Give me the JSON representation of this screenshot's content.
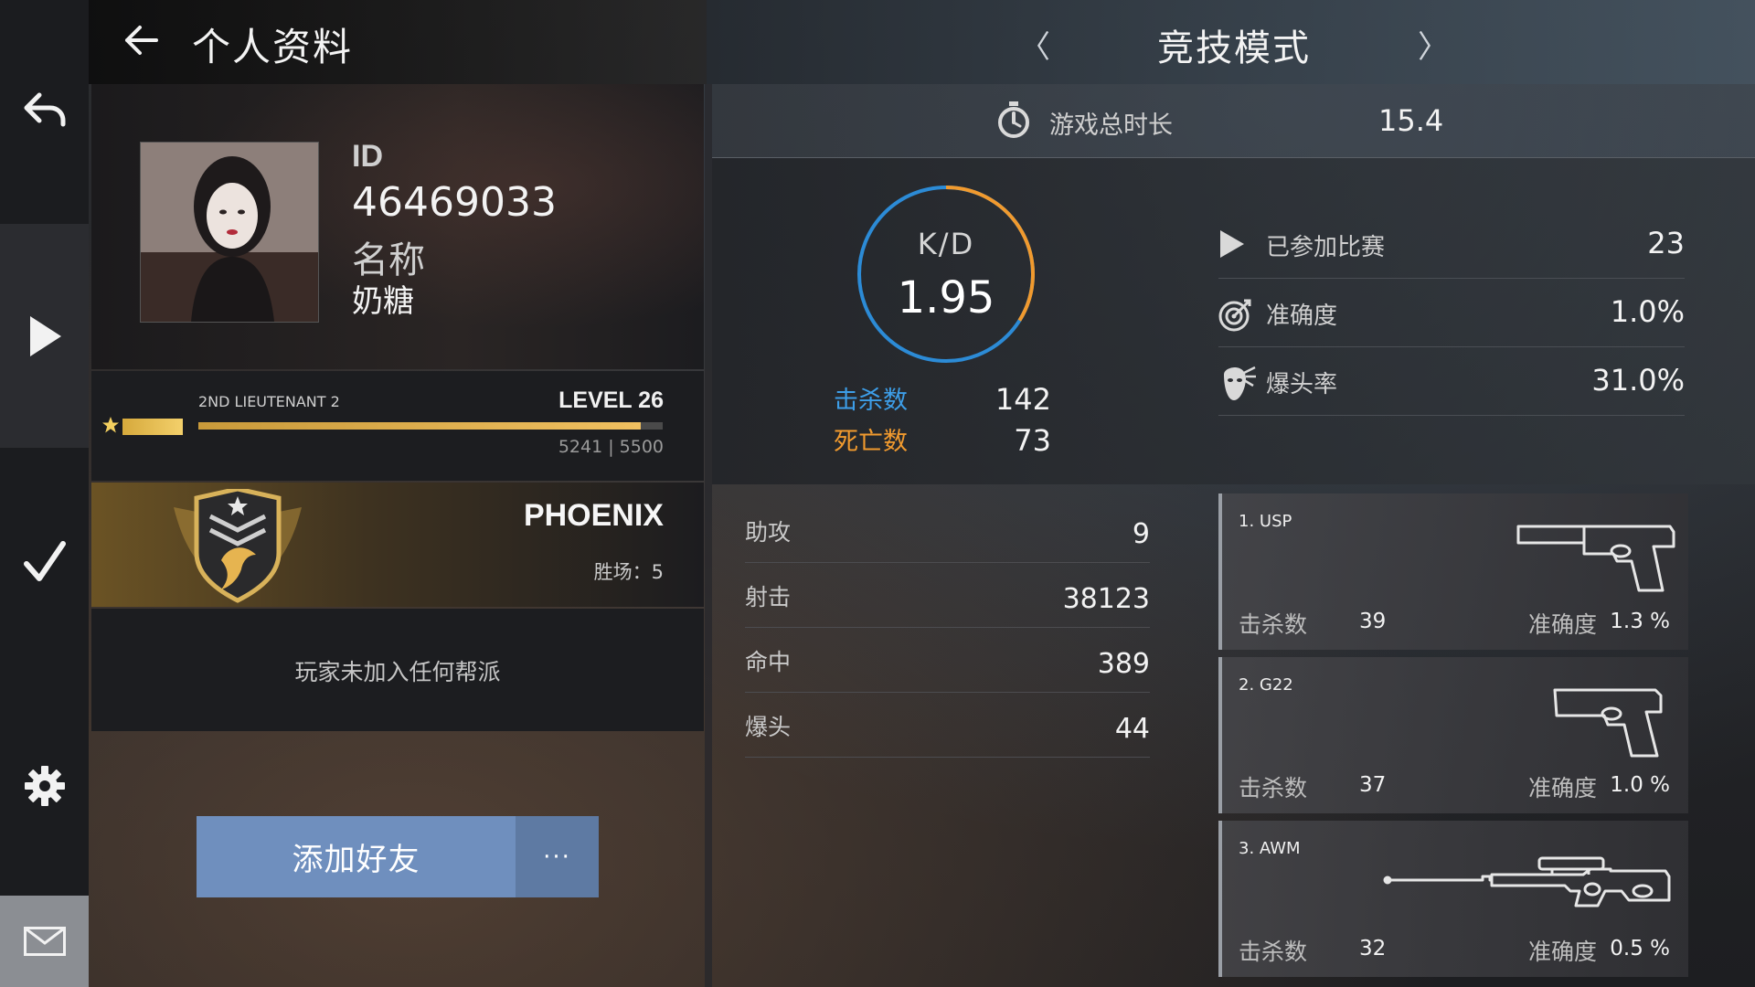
{
  "header": {
    "title": "个人资料",
    "mode_title": "竞技模式",
    "mode_prev": "〈",
    "mode_next": "〉"
  },
  "sidebar": {
    "items": [
      {
        "name": "back",
        "icon": "undo-arrow-icon"
      },
      {
        "name": "play",
        "icon": "play-icon"
      },
      {
        "name": "confirm",
        "icon": "checkmark-icon"
      },
      {
        "name": "settings",
        "icon": "gear-icon"
      },
      {
        "name": "mail",
        "icon": "mail-icon"
      }
    ]
  },
  "profile": {
    "id_label": "ID",
    "id_value": "46469033",
    "name_label": "名称",
    "name_value": "奶糖"
  },
  "rank": {
    "title": "2ND LIEUTENANT 2",
    "level": "LEVEL 26",
    "xp_current": 5241,
    "xp_max": 5500,
    "xp_text": "5241 | 5500"
  },
  "badge": {
    "name": "PHOENIX",
    "wins": "胜场：5"
  },
  "clan": {
    "text": "玩家未加入任何帮派"
  },
  "actions": {
    "add_friend": "添加好友",
    "more": "···"
  },
  "playtime": {
    "label": "游戏总时长",
    "value": "15.4"
  },
  "kd": {
    "label": "K/D",
    "value": "1.95",
    "kills_label": "击杀数",
    "kills": "142",
    "deaths_label": "死亡数",
    "deaths": "73",
    "colors": {
      "kills": "#3d9ee8",
      "deaths": "#f19a2e"
    }
  },
  "stats": [
    {
      "label": "已参加比赛",
      "value": "23",
      "icon": "play-icon"
    },
    {
      "label": "准确度",
      "value": "1.0%",
      "icon": "target-icon"
    },
    {
      "label": "爆头率",
      "value": "31.0%",
      "icon": "headshot-icon"
    }
  ],
  "secondary_stats": [
    {
      "label": "助攻",
      "value": "9"
    },
    {
      "label": "射击",
      "value": "38123"
    },
    {
      "label": "命中",
      "value": "389"
    },
    {
      "label": "爆头",
      "value": "44"
    }
  ],
  "weapons": [
    {
      "name": "1. USP",
      "kills_label": "击杀数",
      "kills": "39",
      "acc_label": "准确度",
      "accuracy": "1.3 %",
      "icon": "silenced-pistol-icon"
    },
    {
      "name": "2. G22",
      "kills_label": "击杀数",
      "kills": "37",
      "acc_label": "准确度",
      "accuracy": "1.0 %",
      "icon": "pistol-icon"
    },
    {
      "name": "3. AWM",
      "kills_label": "击杀数",
      "kills": "32",
      "acc_label": "准确度",
      "accuracy": "0.5 %",
      "icon": "sniper-rifle-icon"
    }
  ]
}
